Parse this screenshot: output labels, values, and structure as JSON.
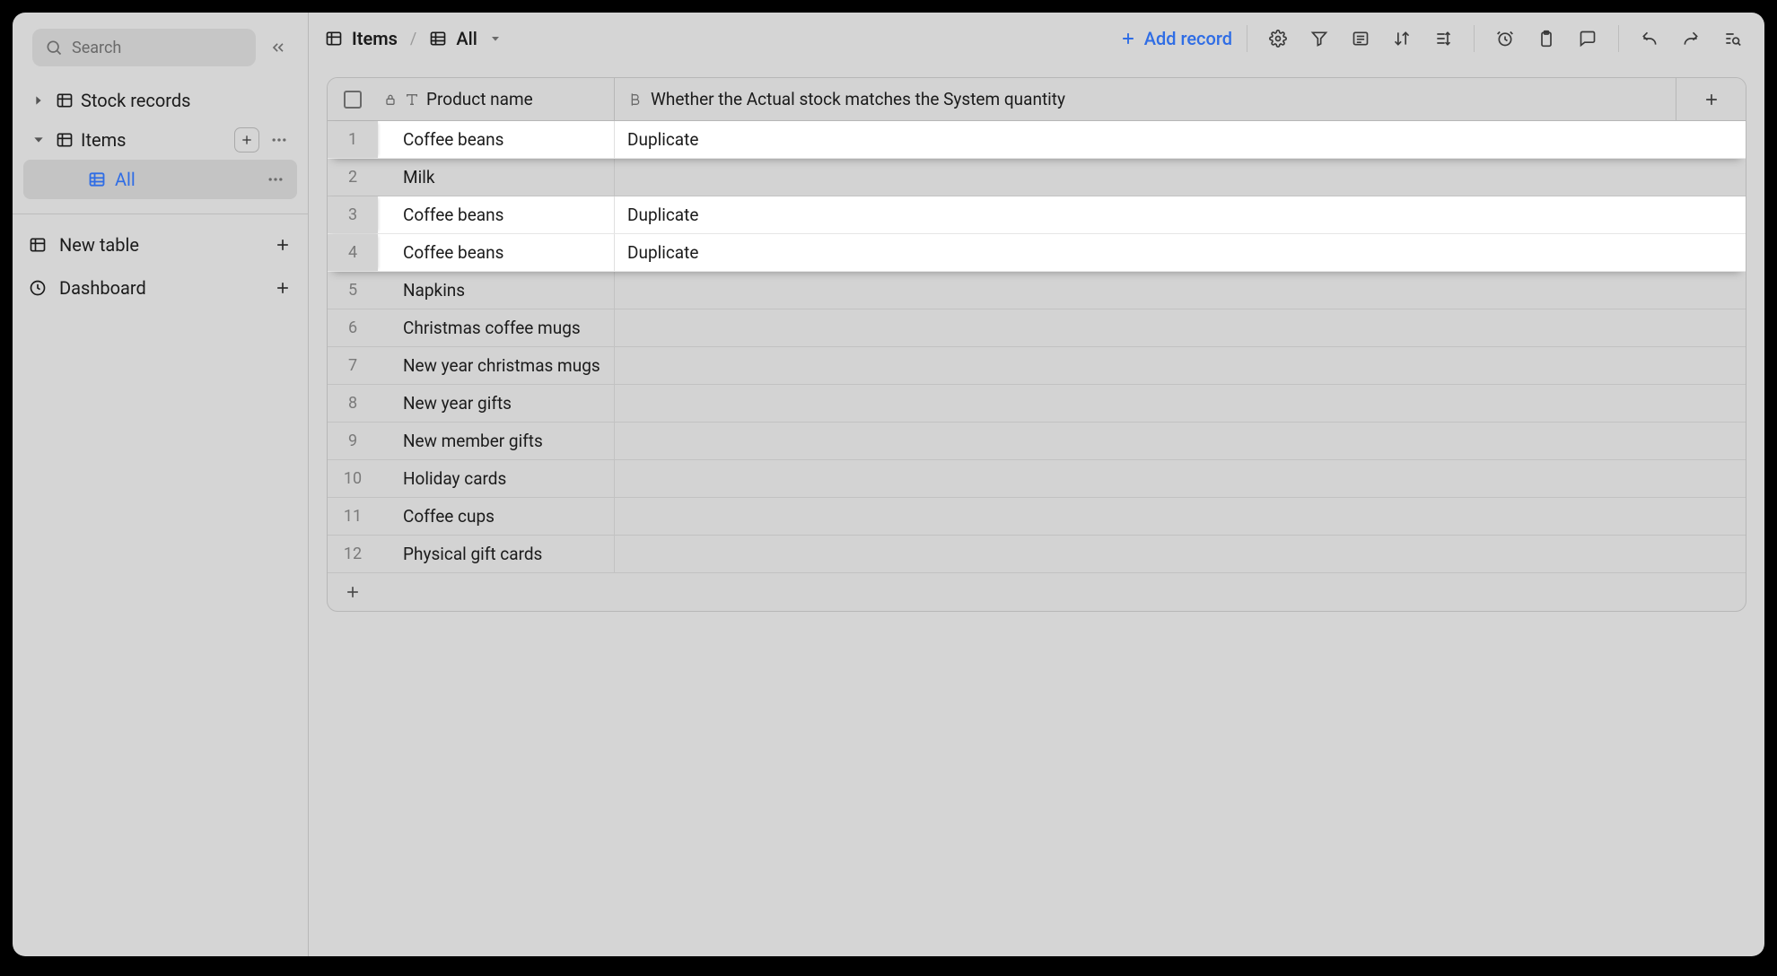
{
  "search": {
    "placeholder": "Search"
  },
  "sidebar": {
    "items": [
      {
        "label": "Stock records",
        "expanded": false
      },
      {
        "label": "Items",
        "expanded": true
      }
    ],
    "views": [
      {
        "label": "All",
        "active": true
      }
    ],
    "actions": {
      "newTable": "New table",
      "dashboard": "Dashboard"
    }
  },
  "breadcrumb": {
    "table": "Items",
    "view": "All"
  },
  "toolbar": {
    "addRecord": "Add record"
  },
  "table": {
    "columns": {
      "productName": "Product name",
      "stockMatch": "Whether the Actual stock matches the System quantity"
    },
    "rows": [
      {
        "n": "1",
        "product": "Coffee beans",
        "status": "Duplicate",
        "highlight": true
      },
      {
        "n": "2",
        "product": "Milk",
        "status": "",
        "highlight": false
      },
      {
        "n": "3",
        "product": "Coffee beans",
        "status": "Duplicate",
        "highlight": true
      },
      {
        "n": "4",
        "product": "Coffee beans",
        "status": "Duplicate",
        "highlight": true
      },
      {
        "n": "5",
        "product": "Napkins",
        "status": "",
        "highlight": false
      },
      {
        "n": "6",
        "product": "Christmas coffee mugs",
        "status": "",
        "highlight": false
      },
      {
        "n": "7",
        "product": "New year christmas mugs",
        "status": "",
        "highlight": false
      },
      {
        "n": "8",
        "product": "New year gifts",
        "status": "",
        "highlight": false
      },
      {
        "n": "9",
        "product": "New member gifts",
        "status": "",
        "highlight": false
      },
      {
        "n": "10",
        "product": "Holiday cards",
        "status": "",
        "highlight": false
      },
      {
        "n": "11",
        "product": "Coffee cups",
        "status": "",
        "highlight": false
      },
      {
        "n": "12",
        "product": "Physical gift cards",
        "status": "",
        "highlight": false
      }
    ]
  }
}
